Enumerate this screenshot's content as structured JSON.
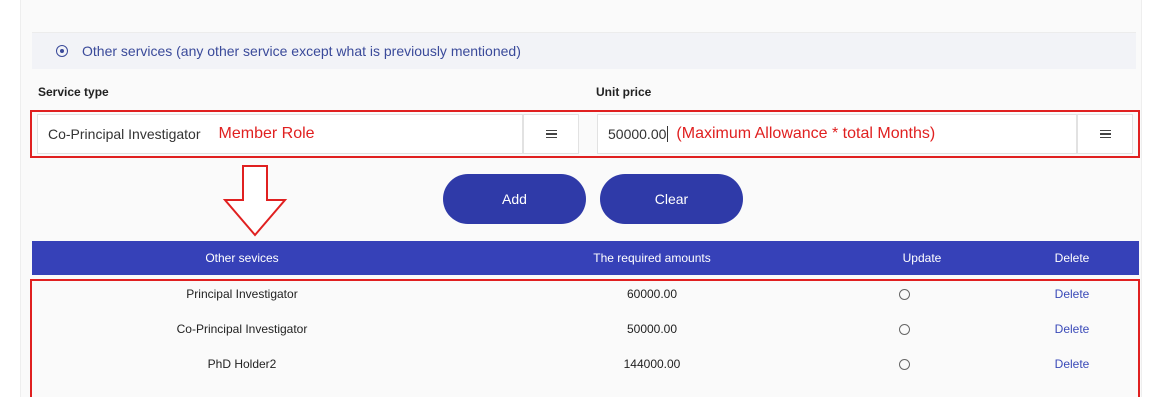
{
  "section": {
    "radio_label": "Other services (any other service except what is previously mentioned)"
  },
  "form": {
    "service_type_label": "Service type",
    "unit_price_label": "Unit price",
    "service_type_value": "Co-Principal Investigator",
    "service_type_note": "Member Role",
    "unit_price_value": "50000.00",
    "unit_price_note": "(Maximum Allowance * total Months)"
  },
  "buttons": {
    "add": "Add",
    "clear": "Clear"
  },
  "table": {
    "headers": [
      "Other sevices",
      "The required amounts",
      "Update",
      "Delete"
    ],
    "rows": [
      {
        "service": "Principal Investigator",
        "amount": "60000.00",
        "delete": "Delete"
      },
      {
        "service": "Co-Principal Investigator",
        "amount": "50000.00",
        "delete": "Delete"
      },
      {
        "service": "PhD Holder2",
        "amount": "144000.00",
        "delete": "Delete"
      }
    ]
  },
  "colors": {
    "primary": "#3641b8",
    "button": "#2f3aa8",
    "annotation_red": "#e02020",
    "link": "#3a4ab8"
  },
  "icons": [
    "radio-selected-icon",
    "menu-lines-icon",
    "down-arrow-annotation-icon",
    "radio-empty-icon"
  ]
}
